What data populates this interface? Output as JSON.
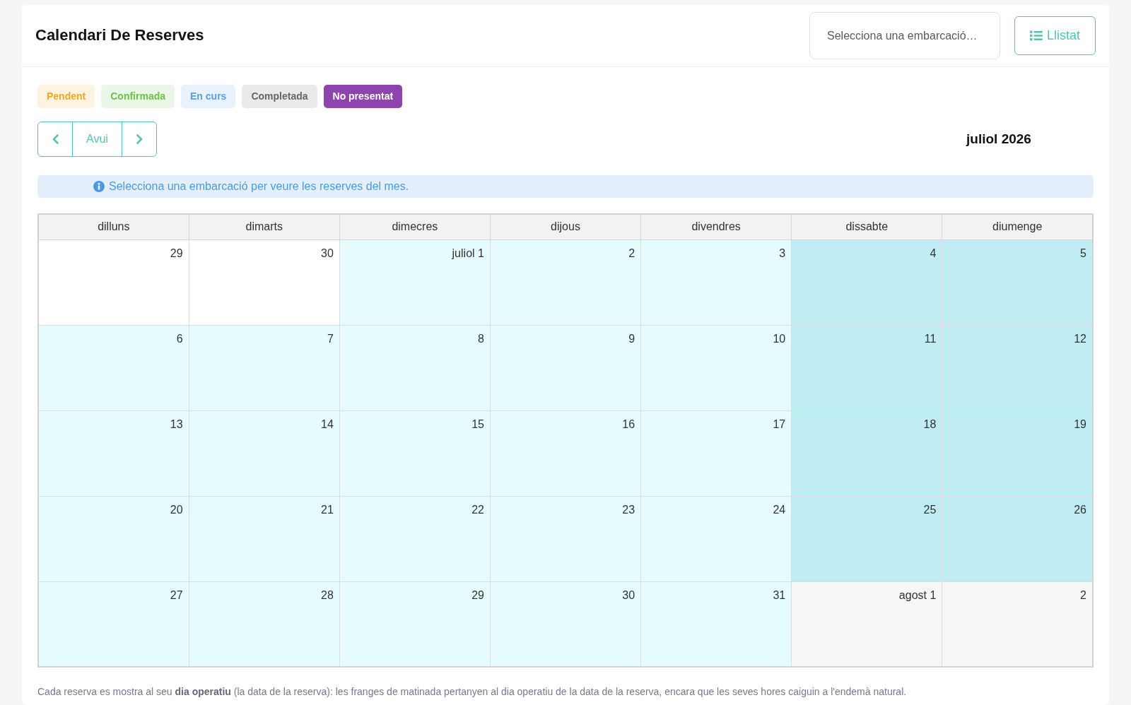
{
  "header": {
    "title": "Calendari De Reserves",
    "boat_select": {
      "placeholder": "Selecciona una embarcació…"
    },
    "list_button": {
      "label": "Llistat"
    }
  },
  "legend": [
    {
      "label": "Pendent",
      "kind": "soft",
      "color": "#f5a623"
    },
    {
      "label": "Confirmada",
      "kind": "soft",
      "color": "#6cc24a"
    },
    {
      "label": "En curs",
      "kind": "soft",
      "color": "#5aa0e6"
    },
    {
      "label": "Completada",
      "kind": "soft",
      "color": "#666666"
    },
    {
      "label": "No presentat",
      "kind": "solid",
      "color": "#8e44ad"
    }
  ],
  "navigation": {
    "today_label": "Avui",
    "month_title": "juliol 2026"
  },
  "info_message": "Selecciona una embarcació per veure les reserves del mes.",
  "calendar": {
    "weekdays": [
      "dilluns",
      "dimarts",
      "dimecres",
      "dijous",
      "divendres",
      "dissabte",
      "diumenge"
    ],
    "weeks": [
      [
        {
          "label": "29",
          "kind": "previous"
        },
        {
          "label": "30",
          "kind": "previous"
        },
        {
          "label": "juliol 1",
          "kind": "current"
        },
        {
          "label": "2",
          "kind": "current"
        },
        {
          "label": "3",
          "kind": "current"
        },
        {
          "label": "4",
          "kind": "weekend"
        },
        {
          "label": "5",
          "kind": "weekend"
        }
      ],
      [
        {
          "label": "6",
          "kind": "current"
        },
        {
          "label": "7",
          "kind": "current"
        },
        {
          "label": "8",
          "kind": "current"
        },
        {
          "label": "9",
          "kind": "current"
        },
        {
          "label": "10",
          "kind": "current"
        },
        {
          "label": "11",
          "kind": "weekend"
        },
        {
          "label": "12",
          "kind": "weekend"
        }
      ],
      [
        {
          "label": "13",
          "kind": "current"
        },
        {
          "label": "14",
          "kind": "current"
        },
        {
          "label": "15",
          "kind": "current"
        },
        {
          "label": "16",
          "kind": "current"
        },
        {
          "label": "17",
          "kind": "current"
        },
        {
          "label": "18",
          "kind": "weekend"
        },
        {
          "label": "19",
          "kind": "weekend"
        }
      ],
      [
        {
          "label": "20",
          "kind": "current"
        },
        {
          "label": "21",
          "kind": "current"
        },
        {
          "label": "22",
          "kind": "current"
        },
        {
          "label": "23",
          "kind": "current"
        },
        {
          "label": "24",
          "kind": "current"
        },
        {
          "label": "25",
          "kind": "weekend"
        },
        {
          "label": "26",
          "kind": "weekend"
        }
      ],
      [
        {
          "label": "27",
          "kind": "current"
        },
        {
          "label": "28",
          "kind": "current"
        },
        {
          "label": "29",
          "kind": "current"
        },
        {
          "label": "30",
          "kind": "current"
        },
        {
          "label": "31",
          "kind": "current"
        },
        {
          "label": "agost 1",
          "kind": "next"
        },
        {
          "label": "2",
          "kind": "next"
        }
      ]
    ]
  },
  "footnote": "Cada reserva es mostra al seu **dia operatiu** (la data de la reserva): les franges de matinada pertanyen al dia operatiu de la data de la reserva, encara que les seves hores caiguin a l'endemà natural."
}
